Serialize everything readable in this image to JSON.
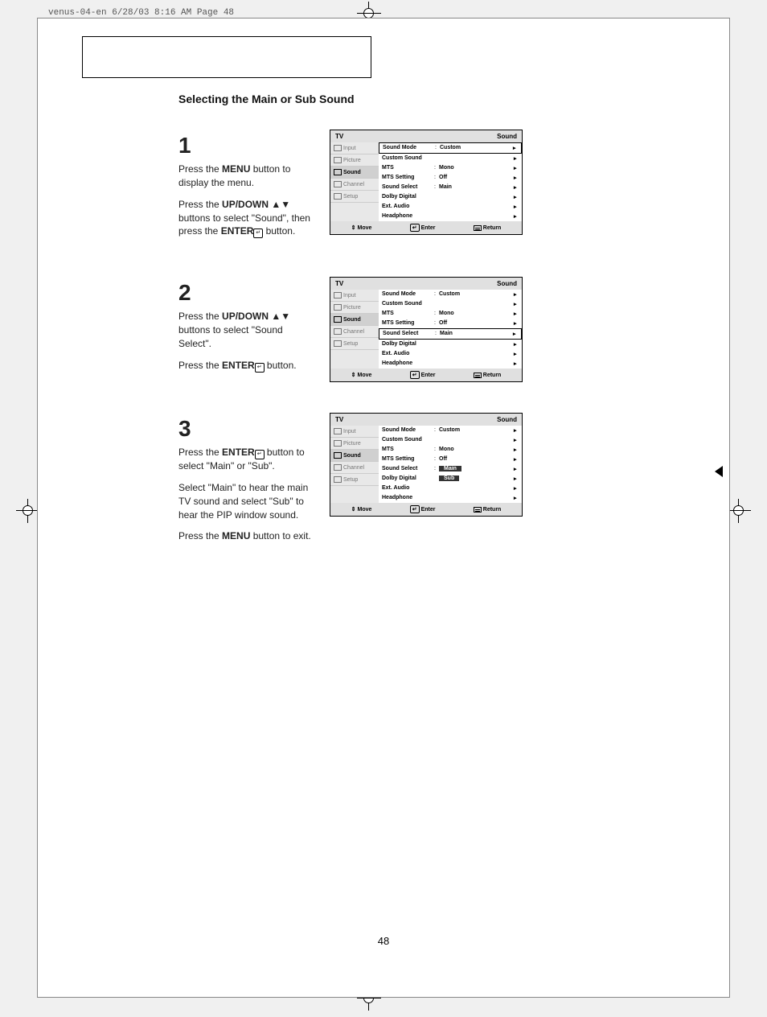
{
  "header_slug": "venus-04-en  6/28/03  8:16 AM  Page 48",
  "title": "Selecting the Main or Sub Sound",
  "page_number": "48",
  "steps": [
    {
      "num": "1",
      "paras": [
        "Press the <b>MENU</b> button to display the menu.",
        "Press the <b>UP/DOWN</b> ▲▼ buttons to select \"Sound\", then press the <b>ENTER</b><span class='enter-ic'>↵</span> button."
      ]
    },
    {
      "num": "2",
      "paras": [
        "Press the <b>UP/DOWN</b> ▲▼ buttons to select \"Sound Select\".",
        "Press the <b>ENTER</b><span class='enter-ic'>↵</span> button."
      ]
    },
    {
      "num": "3",
      "paras": [
        "Press the <b>ENTER</b><span class='enter-ic'>↵</span> button to select \"Main\" or \"Sub\".",
        "Select \"Main\" to hear the main TV sound and select \"Sub\" to hear the PIP window sound.",
        "Press the <b>MENU</b> button to exit."
      ]
    }
  ],
  "osd": {
    "top_left": "TV",
    "top_right": "Sound",
    "nav": [
      "Input",
      "Picture",
      "Sound",
      "Channel",
      "Setup"
    ],
    "nav_sel_index": 2,
    "rows": [
      {
        "lbl": "Sound Mode",
        "val": "Custom"
      },
      {
        "lbl": "Custom Sound",
        "val": ""
      },
      {
        "lbl": "MTS",
        "val": "Mono"
      },
      {
        "lbl": "MTS Setting",
        "val": "Off"
      },
      {
        "lbl": "Sound Select",
        "val": "Main"
      },
      {
        "lbl": "Dolby Digital",
        "val": ""
      },
      {
        "lbl": "Ext. Audio",
        "val": ""
      },
      {
        "lbl": "Headphone",
        "val": ""
      }
    ],
    "foot": {
      "move": "Move",
      "enter": "Enter",
      "return": "Return"
    }
  },
  "osd3_options": {
    "main": "Main",
    "sub": "Sub"
  }
}
